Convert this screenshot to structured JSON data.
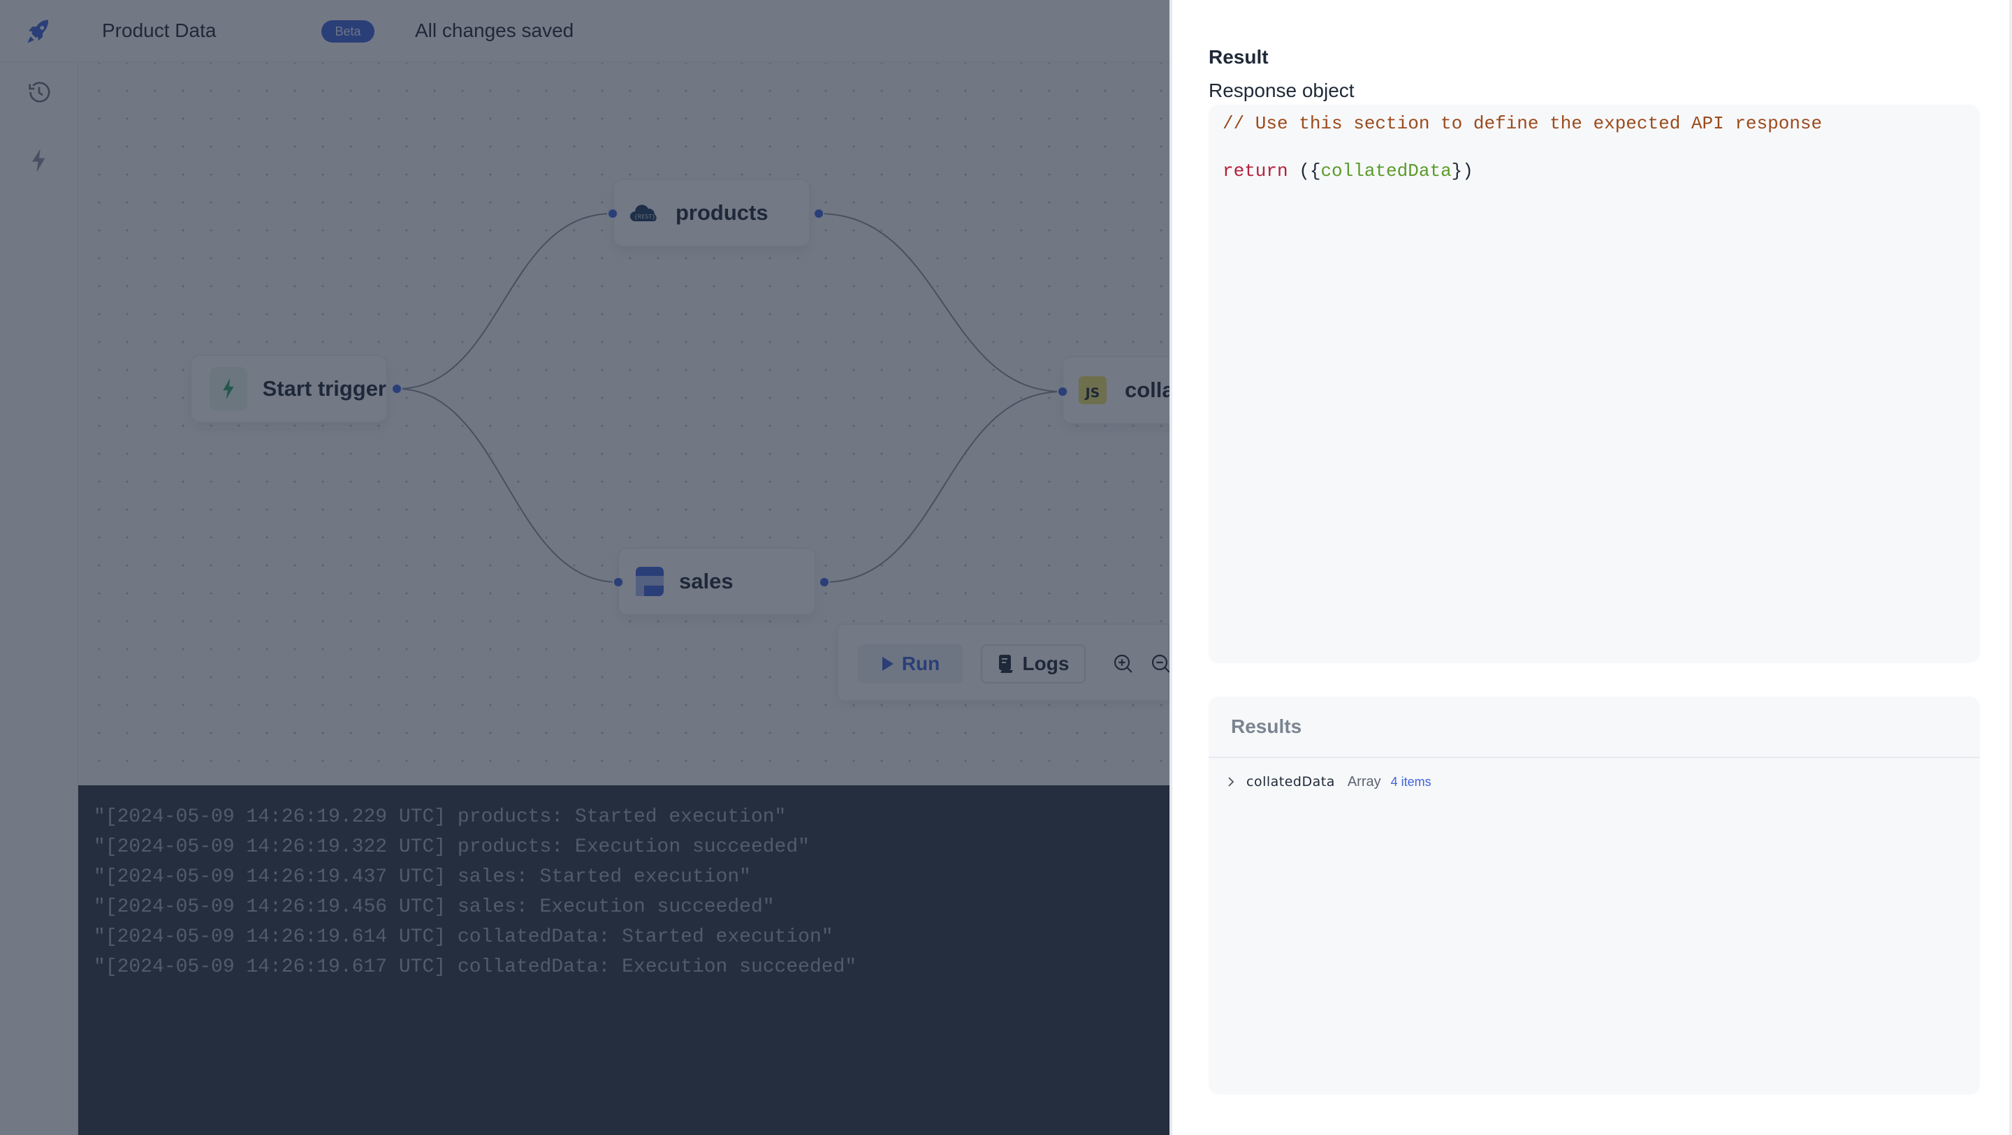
{
  "header": {
    "app_title": "Product Data",
    "badge": "Beta",
    "save_status": "All changes saved",
    "logo_icon": "rocket-icon"
  },
  "sidebar": {
    "items": [
      {
        "name": "history",
        "icon": "history-icon"
      },
      {
        "name": "triggers",
        "icon": "lightning-icon"
      }
    ]
  },
  "canvas": {
    "nodes": [
      {
        "id": "start",
        "label": "Start trigger",
        "icon": "lightning-icon"
      },
      {
        "id": "products",
        "label": "products",
        "icon": "rest-api-cloud-icon",
        "icon_text": "{REST}"
      },
      {
        "id": "sales",
        "label": "sales",
        "icon": "table-icon"
      },
      {
        "id": "collated",
        "label": "colla",
        "icon": "javascript-icon",
        "icon_text": "JS"
      }
    ],
    "toolbar": {
      "run_label": "Run",
      "logs_label": "Logs"
    }
  },
  "logs": [
    "\"[2024-05-09 14:26:19.229 UTC] products: Started execution\"",
    "\"[2024-05-09 14:26:19.322 UTC] products: Execution succeeded\"",
    "\"[2024-05-09 14:26:19.437 UTC] sales: Started execution\"",
    "\"[2024-05-09 14:26:19.456 UTC] sales: Execution succeeded\"",
    "\"[2024-05-09 14:26:19.614 UTC] collatedData: Started execution\"",
    "\"[2024-05-09 14:26:19.617 UTC] collatedData: Execution succeeded\""
  ],
  "drawer": {
    "title": "Result",
    "response_label": "Response object",
    "code": {
      "comment": "// Use this section to define the expected API response",
      "keyword": "return",
      "open": " ({",
      "variable": "collatedData",
      "close": "})"
    },
    "results": {
      "header": "Results",
      "rows": [
        {
          "key": "collatedData",
          "type": "Array",
          "count": "4 items"
        }
      ]
    }
  },
  "colors": {
    "accent": "#3e63dd",
    "overlay": "#1e283a",
    "logs_bg": "#2d3748",
    "code_comment": "#9b4a1c",
    "code_keyword": "#b3213b",
    "code_variable": "#5c9a2a"
  }
}
